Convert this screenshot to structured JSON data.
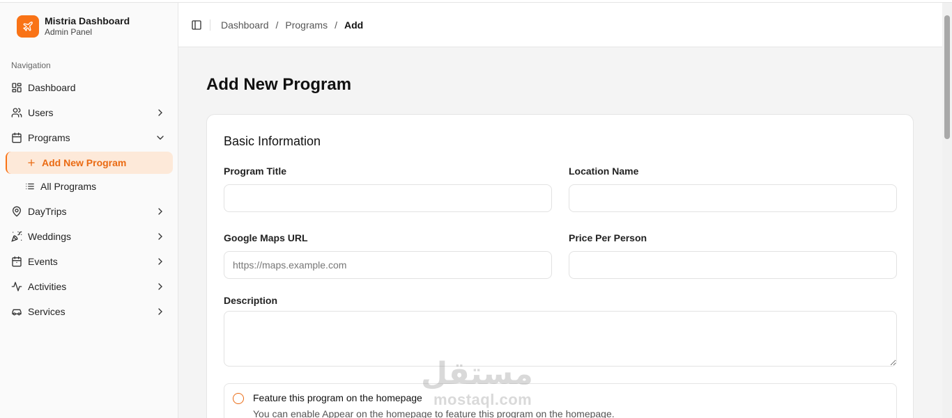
{
  "brand": {
    "title": "Mistria Dashboard",
    "subtitle": "Admin Panel"
  },
  "sidebar": {
    "heading": "Navigation",
    "items": [
      {
        "label": "Dashboard",
        "icon": "grid-icon"
      },
      {
        "label": "Users",
        "icon": "users-icon"
      },
      {
        "label": "Programs",
        "icon": "calendar-icon"
      },
      {
        "label": "DayTrips",
        "icon": "map-pin-icon"
      },
      {
        "label": "Weddings",
        "icon": "party-popper-icon"
      },
      {
        "label": "Events",
        "icon": "calendar-event-icon"
      },
      {
        "label": "Activities",
        "icon": "activity-icon"
      },
      {
        "label": "Services",
        "icon": "car-icon"
      }
    ],
    "programs_sub": [
      {
        "label": "Add New Program",
        "icon": "plus-icon",
        "active": true
      },
      {
        "label": "All Programs",
        "icon": "list-icon",
        "active": false
      }
    ]
  },
  "breadcrumb": {
    "items": [
      "Dashboard",
      "Programs",
      "Add"
    ],
    "separator": "/"
  },
  "page": {
    "title": "Add New Program"
  },
  "form": {
    "section_title": "Basic Information",
    "program_title": {
      "label": "Program Title",
      "value": "",
      "placeholder": ""
    },
    "location_name": {
      "label": "Location Name",
      "value": "",
      "placeholder": ""
    },
    "maps_url": {
      "label": "Google Maps URL",
      "value": "",
      "placeholder": "https://maps.example.com"
    },
    "price": {
      "label": "Price Per Person",
      "value": "",
      "placeholder": ""
    },
    "description": {
      "label": "Description",
      "value": "",
      "placeholder": ""
    },
    "feature": {
      "title": "Feature this program on the homepage",
      "description": "You can enable Appear on the homepage to feature this program on the homepage."
    }
  },
  "colors": {
    "accent": "#f97316",
    "accent_bg": "#fde9d9",
    "accent_text": "#ea6a12"
  },
  "watermark": {
    "arabic": "مستقل",
    "latin": "mostaql.com"
  }
}
